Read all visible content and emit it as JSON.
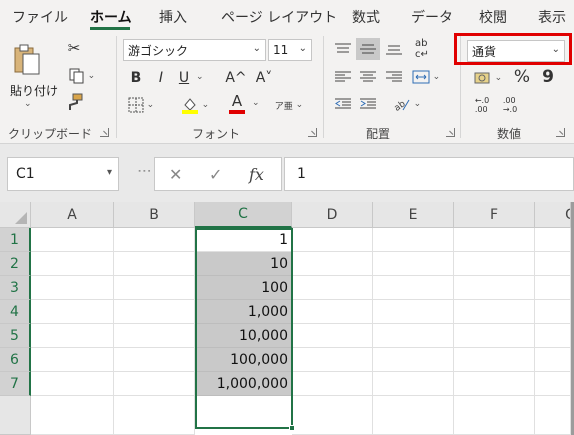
{
  "ribbon_tabs": [
    "ファイル",
    "ホーム",
    "挿入",
    "ページ レイアウト",
    "数式",
    "データ",
    "校閲",
    "表示"
  ],
  "active_tab": "ホーム",
  "clipboard": {
    "paste_label": "貼り付け",
    "group_label": "クリップボード"
  },
  "font": {
    "name": "游ゴシック",
    "size": "11",
    "group_label": "フォント",
    "bold": "B",
    "italic": "I",
    "underline": "U",
    "grow": "A^",
    "shrink": "A˅",
    "font_color_letter": "A",
    "highlight_color": "#ffff00",
    "font_color": "#e00000",
    "phonetic": "ア亜"
  },
  "alignment": {
    "group_label": "配置"
  },
  "number": {
    "format": "通貨",
    "group_label": "数値",
    "percent": "%",
    "comma": "9"
  },
  "formula_bar": {
    "name_box": "C1",
    "fx": "fx",
    "value": "1",
    "cancel": "✕",
    "enter": "✓"
  },
  "grid": {
    "columns": [
      "A",
      "B",
      "C",
      "D",
      "E",
      "F",
      "G"
    ],
    "rows": [
      "1",
      "2",
      "3",
      "4",
      "5",
      "6",
      "7"
    ],
    "selected_column": "C",
    "column_c_values": [
      "1",
      "10",
      "100",
      "1,000",
      "10,000",
      "100,000",
      "1,000,000"
    ]
  },
  "colors": {
    "excel_green": "#217346",
    "highlight_red": "#e00000"
  }
}
